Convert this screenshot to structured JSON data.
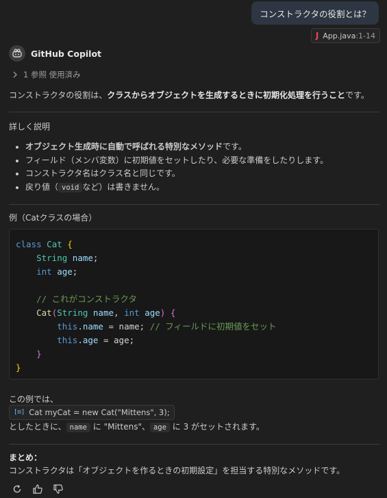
{
  "user_message": "コンストラクタの役割とは？",
  "reference_chip": {
    "file": "App.java",
    "range": ":1-14",
    "icon": "java-icon"
  },
  "agent": {
    "name": "GitHub Copilot",
    "icon": "copilot-icon"
  },
  "refs_toggle": "1 参照 使用済み",
  "summary": {
    "pre": "コンストラクタの役割は、",
    "bold": "クラスからオブジェクトを生成するときに初期化処理を行うこと",
    "post": "です。"
  },
  "section_details": "詳しく説明",
  "bullets": [
    {
      "bold": "オブジェクト生成時に自動で呼ばれる特別なメソッド",
      "text": "です。"
    },
    {
      "text": "フィールド（メンバ変数）に初期値をセットしたり、必要な準備をしたりします。"
    },
    {
      "text": "コンストラクタ名はクラス名と同じです。"
    },
    {
      "pre": "戻り値（",
      "code": "void",
      "post": "など）は書きません。"
    }
  ],
  "section_example": "例（Catクラスの場合）",
  "code": {
    "line1": {
      "kw": "class",
      "name": "Cat",
      "brace": "{"
    },
    "line2": {
      "type": "String",
      "name": "name",
      "semi": ";"
    },
    "line3": {
      "type": "int",
      "name": "age",
      "semi": ";"
    },
    "line5": {
      "comment": "// これがコンストラクタ"
    },
    "line6": {
      "fn": "Cat",
      "open": "(",
      "t1": "String",
      "p1": "name",
      "comma": ",",
      "t2": "int",
      "p2": "age",
      "close": ")",
      "brace": "{"
    },
    "line7": {
      "this": "this",
      "dot": ".",
      "field": "name",
      "assign": " = name;",
      "comment": "// フィールドに初期値をセット"
    },
    "line8": {
      "this": "this",
      "dot": ".",
      "field": "age",
      "assign": " = age;"
    },
    "line9": {
      "brace": "}"
    },
    "line10": {
      "brace": "}"
    }
  },
  "example_intro": "この例では、",
  "symbol_chip": {
    "icon": "symbol-variable-icon",
    "text": "Cat myCat = new Cat(\"Mittens\", 3);"
  },
  "example_result": {
    "pre": "としたときに、",
    "code1": "name",
    "mid1": "に \"Mittens\"、",
    "code2": "age",
    "post": "に 3 がセットされます。"
  },
  "conclusion": {
    "title": "まとめ：",
    "text": "コンストラクタは「オブジェクトを作るときの初期設定」を担当する特別なメソッドです。"
  },
  "actions": [
    "retry-icon",
    "thumbs-up-icon",
    "thumbs-down-icon"
  ]
}
